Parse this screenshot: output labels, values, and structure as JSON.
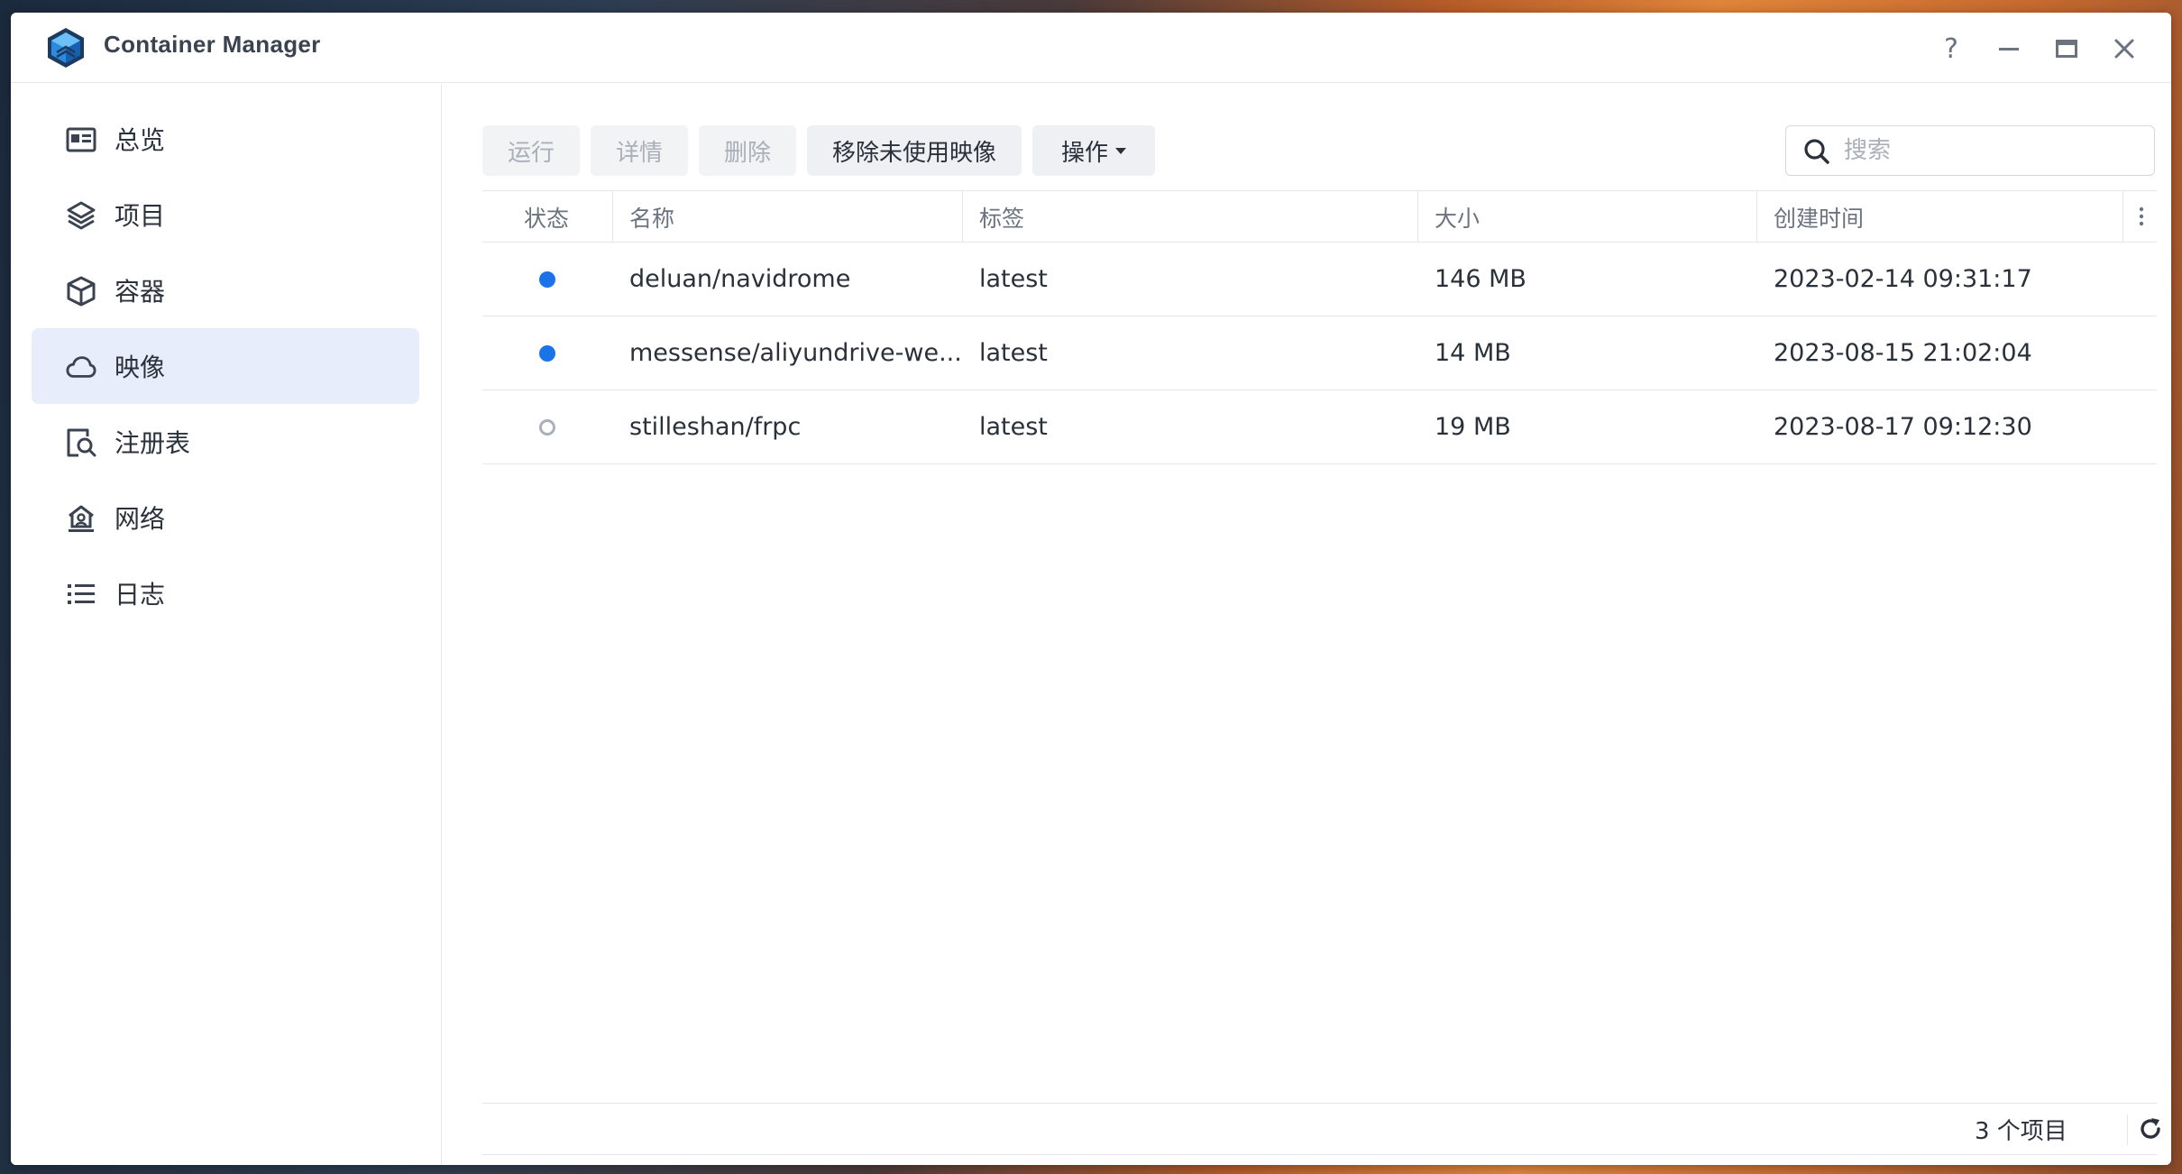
{
  "window": {
    "title": "Container Manager",
    "controls": {
      "help": "?"
    }
  },
  "sidebar": {
    "items": [
      {
        "label": "总览",
        "icon": "overview-icon"
      },
      {
        "label": "项目",
        "icon": "layers-icon"
      },
      {
        "label": "容器",
        "icon": "cube-icon"
      },
      {
        "label": "映像",
        "icon": "cloud-icon",
        "active": true
      },
      {
        "label": "注册表",
        "icon": "registry-search-icon"
      },
      {
        "label": "网络",
        "icon": "network-icon"
      },
      {
        "label": "日志",
        "icon": "list-icon"
      }
    ]
  },
  "toolbar": {
    "run_label": "运行",
    "detail_label": "详情",
    "delete_label": "删除",
    "remove_unused_label": "移除未使用映像",
    "action_label": "操作"
  },
  "search": {
    "placeholder": "搜索",
    "value": ""
  },
  "table": {
    "columns": [
      "状态",
      "名称",
      "标签",
      "大小",
      "创建时间"
    ],
    "rows": [
      {
        "status": "running",
        "name": "deluan/navidrome",
        "tag": "latest",
        "size": "146 MB",
        "created": "2023-02-14 09:31:17"
      },
      {
        "status": "running",
        "name": "messense/aliyundrive-we...",
        "tag": "latest",
        "size": "14 MB",
        "created": "2023-08-15 21:02:04"
      },
      {
        "status": "stopped",
        "name": "stilleshan/frpc",
        "tag": "latest",
        "size": "19 MB",
        "created": "2023-08-17 09:12:30"
      }
    ]
  },
  "footer": {
    "count_label": "3 个项目"
  },
  "colors": {
    "accent": "#1a73e8",
    "active_bg": "#e7edfa",
    "stopped": "#a9b0ba"
  }
}
